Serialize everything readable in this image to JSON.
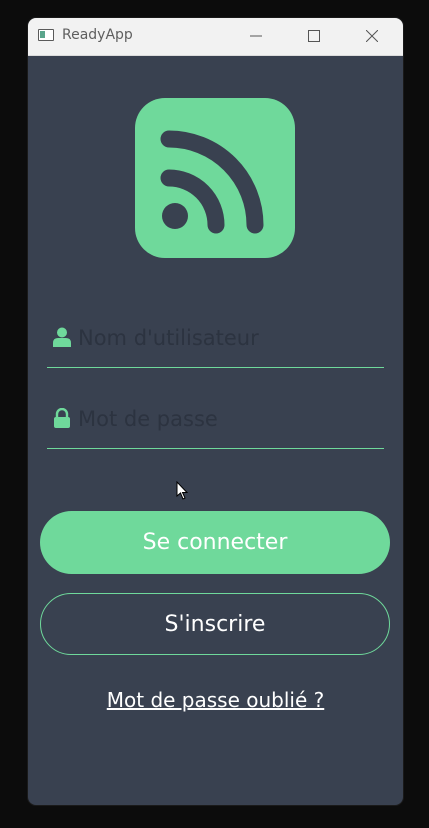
{
  "window": {
    "title": "ReadyApp",
    "controls": {
      "minimize_icon": "minimize-icon",
      "maximize_icon": "maximize-icon",
      "close_icon": "close-icon"
    }
  },
  "logo": {
    "icon": "rss-feed-icon",
    "color": "#6fd99b"
  },
  "form": {
    "username": {
      "placeholder": "Nom d'utilisateur",
      "value": "",
      "icon": "user-icon"
    },
    "password": {
      "placeholder": "Mot de passe",
      "value": "",
      "icon": "lock-icon"
    }
  },
  "actions": {
    "login_label": "Se connecter",
    "signup_label": "S'inscrire",
    "forgot_label": "Mot de passe oublié ?"
  },
  "colors": {
    "accent": "#6fd99b",
    "background": "#394150",
    "titlebar": "#f2f2f2"
  }
}
